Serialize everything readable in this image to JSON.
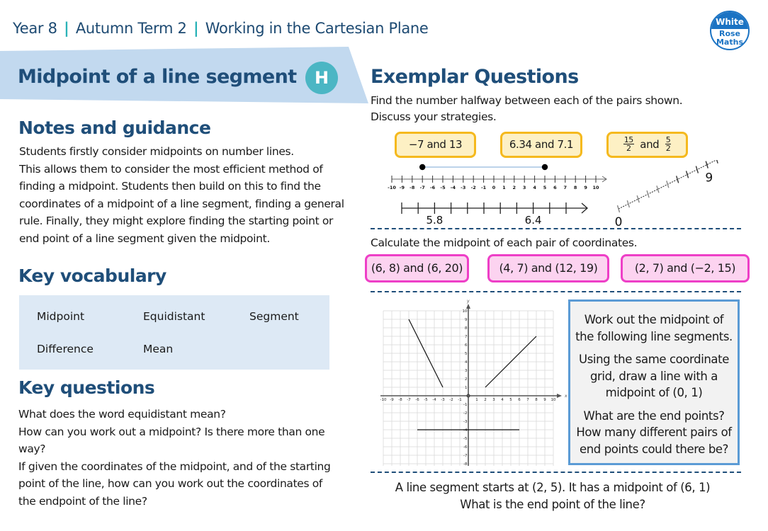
{
  "header": {
    "year": "Year 8",
    "term": "Autumn Term 2",
    "unit": "Working in the Cartesian Plane",
    "separator": "|"
  },
  "logo": {
    "line1": "White",
    "line2": "Rose",
    "line3": "Maths"
  },
  "topic": {
    "title": "Midpoint of a line segment",
    "badge": "H"
  },
  "notes": {
    "heading": "Notes and guidance",
    "lines": [
      "Students firstly consider midpoints on number lines.",
      "This allows them to consider the most efficient method of",
      "finding a midpoint. Students then build on this to find the",
      "coordinates of a midpoint of a line segment, finding a general",
      "rule. Finally, they might explore finding the starting point or",
      "end point of a line segment given the midpoint."
    ]
  },
  "vocabulary": {
    "heading": "Key vocabulary",
    "words": [
      "Midpoint",
      "Equidistant",
      "Segment",
      "Difference",
      "Mean"
    ]
  },
  "key_questions": {
    "heading": "Key questions",
    "lines": [
      "What does the word equidistant mean?",
      "How can you work out a midpoint? Is there more than one",
      "way?",
      "If given the coordinates of the midpoint, and of the starting",
      "point of the line, how can you work out the coordinates of",
      "the endpoint of the line?"
    ]
  },
  "exemplar": {
    "heading": "Exemplar Questions",
    "q1": {
      "prompt_line1": "Find the number halfway between each of the pairs shown.",
      "prompt_line2": "Discuss your strategies.",
      "cards": [
        "−7 and 13",
        "6.34 and 7.1"
      ],
      "fraction_card": {
        "a_num": "15",
        "a_den": "2",
        "joiner": "and",
        "b_num": "5",
        "b_den": "2"
      },
      "number_line_1": {
        "min": -10,
        "max": 10,
        "marked_points": [
          -7,
          5
        ],
        "labels": [
          "-10",
          "-9",
          "-8",
          "-7",
          "-6",
          "-5",
          "-4",
          "-3",
          "-2",
          "-1",
          "0",
          "1",
          "2",
          "3",
          "4",
          "5",
          "6",
          "7",
          "8",
          "9",
          "10"
        ]
      },
      "number_line_2": {
        "labels": [
          "5.8",
          "6.4"
        ]
      },
      "number_line_3": {
        "labels": [
          "0",
          "9"
        ]
      }
    },
    "q2": {
      "prompt": "Calculate the midpoint of each pair of coordinates.",
      "cards": [
        "(6, 8) and (6, 20)",
        "(4, 7) and (12, 19)",
        "(2, 7) and (−2, 15)"
      ]
    },
    "q3": {
      "grid": {
        "x_label": "x",
        "y_label": "y",
        "range": [
          -10,
          10
        ],
        "segments": [
          {
            "from": [
              -7,
              9
            ],
            "to": [
              -3,
              1
            ]
          },
          {
            "from": [
              2,
              1
            ],
            "to": [
              8,
              7
            ]
          },
          {
            "from": [
              -6,
              -4
            ],
            "to": [
              6,
              -4
            ]
          }
        ]
      },
      "box_paragraphs": [
        "Work out the midpoint of the following line segments.",
        "Using the same coordinate grid, draw a line with a midpoint of (0, 1)",
        "What are the end points? How many different pairs of end points could there be?"
      ]
    },
    "q4": {
      "line1": "A line segment starts at (2, 5). It has a midpoint of (6, 1)",
      "line2": "What is the end point of the line?"
    }
  },
  "colors": {
    "navy": "#1f4e79",
    "teal": "#2bb3b8",
    "band": "#c2d9ef",
    "vocab_bg": "#dde9f5",
    "yellow_fill": "#fdf0c4",
    "yellow_border": "#f5b91e",
    "pink_fill": "#fcd3f0",
    "pink_border": "#ee3fc7",
    "box_border": "#5b9bd5"
  }
}
